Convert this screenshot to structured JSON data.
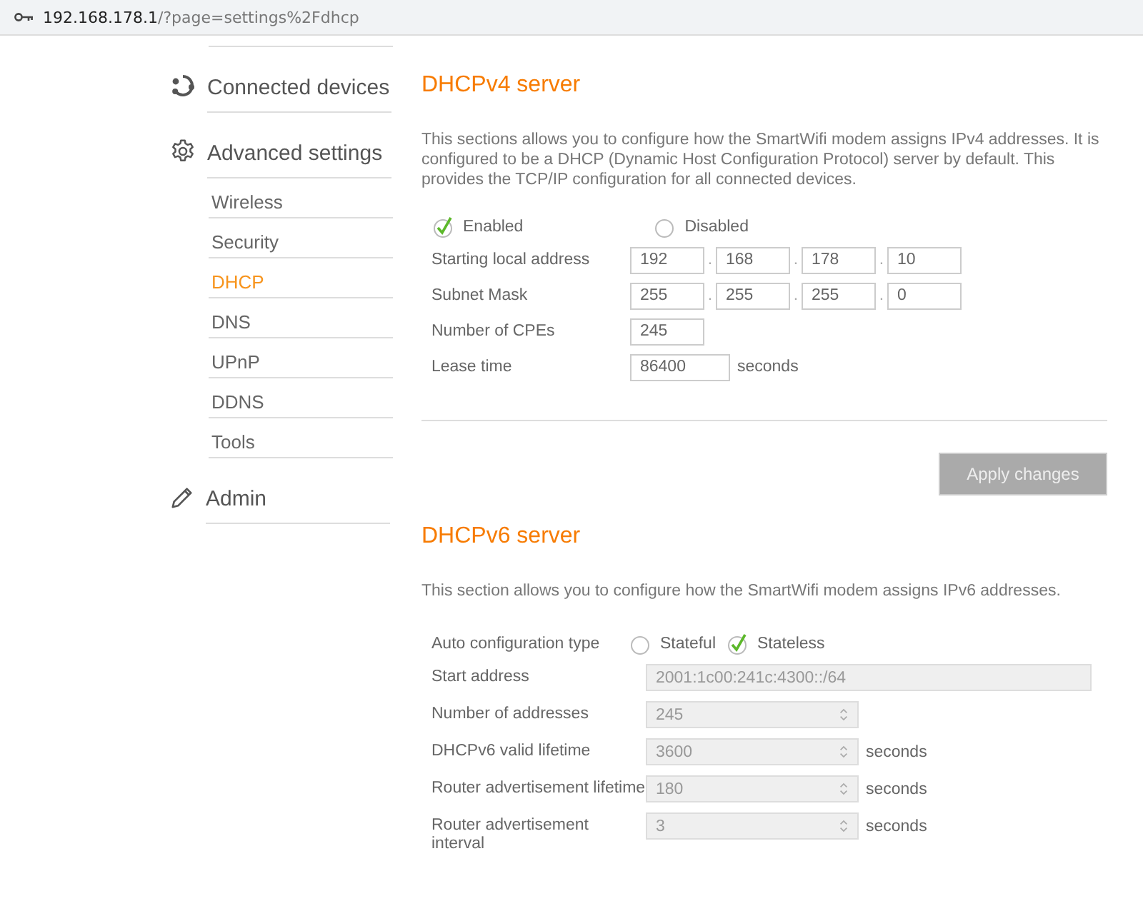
{
  "address_bar": {
    "host": "192.168.178.1",
    "path": "/?page=settings%2Fdhcp"
  },
  "sidebar": {
    "sections": [
      {
        "label": "Connected devices"
      },
      {
        "label": "Advanced settings",
        "children": [
          {
            "label": "Wireless",
            "selected": false
          },
          {
            "label": "Security",
            "selected": false
          },
          {
            "label": "DHCP",
            "selected": true
          },
          {
            "label": "DNS",
            "selected": false
          },
          {
            "label": "UPnP",
            "selected": false
          },
          {
            "label": "DDNS",
            "selected": false
          },
          {
            "label": "Tools",
            "selected": false
          }
        ]
      },
      {
        "label": "Admin"
      }
    ]
  },
  "dhcpv4": {
    "title": "DHCPv4 server",
    "description": "This sections allows you to configure how the SmartWifi modem assigns IPv4 addresses. It is configured to be a DHCP (Dynamic Host Configuration Protocol) server by default. This provides the TCP/IP configuration for all connected devices.",
    "mode": [
      {
        "label": "Enabled",
        "selected": true
      },
      {
        "label": "Disabled",
        "selected": false
      }
    ],
    "fields": [
      {
        "label": "Starting local address",
        "values": [
          "192",
          "168",
          "178",
          "10"
        ],
        "separators": [
          ".",
          ".",
          "."
        ]
      },
      {
        "label": "Subnet Mask",
        "values": [
          "255",
          "255",
          "255",
          "0"
        ],
        "separators": [
          ".",
          ".",
          "."
        ]
      },
      {
        "label": "Number of CPEs",
        "values": [
          "245"
        ]
      },
      {
        "label": "Lease time",
        "values": [
          "86400"
        ],
        "unit": "seconds"
      }
    ],
    "apply_button": {
      "label": "Apply changes",
      "disabled": true
    }
  },
  "dhcpv6": {
    "title": "DHCPv6 server",
    "description": "This section allows you to configure how the SmartWifi modem assigns IPv6 addresses.",
    "auto_config": {
      "label": "Auto configuration type",
      "options": [
        {
          "label": "Stateful",
          "selected": false
        },
        {
          "label": "Stateless",
          "selected": true
        }
      ]
    },
    "fields": [
      {
        "kind": "text",
        "label": "Start address",
        "value": "2001:1c00:241c:4300::/64",
        "disabled": true
      },
      {
        "kind": "spin",
        "label": "Number of addresses",
        "value": "245",
        "disabled": true
      },
      {
        "kind": "spin",
        "label": "DHCPv6 valid lifetime",
        "value": "3600",
        "unit": "seconds",
        "disabled": true
      },
      {
        "kind": "spin",
        "label": "Router advertisement lifetime",
        "value": "180",
        "unit": "seconds",
        "disabled": true
      },
      {
        "kind": "spin",
        "label": "Router advertisement interval",
        "value": "3",
        "unit": "seconds",
        "disabled": true
      }
    ]
  }
}
